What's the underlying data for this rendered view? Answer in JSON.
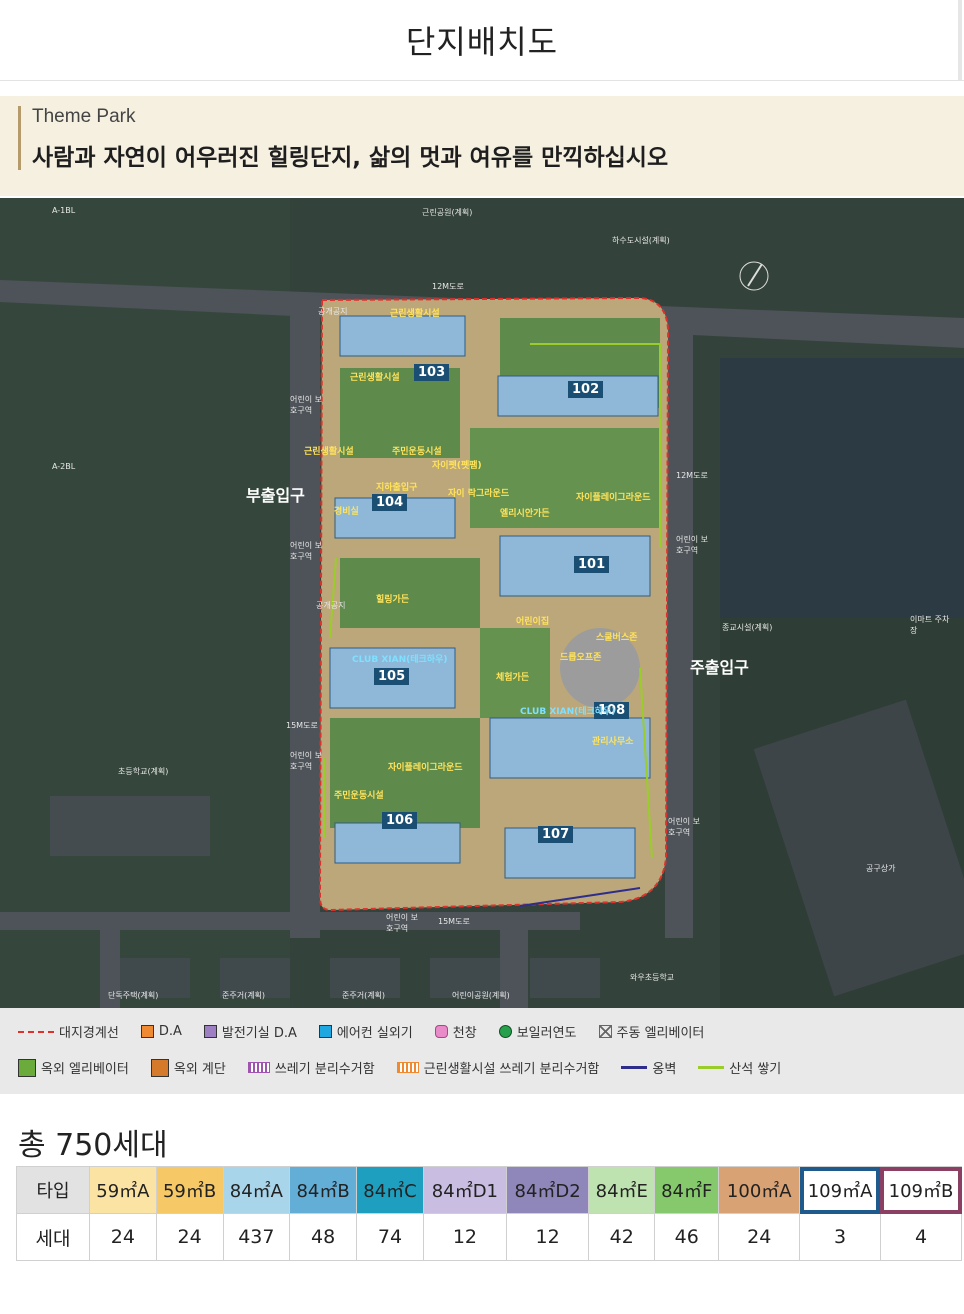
{
  "header": {
    "title": "단지배치도"
  },
  "banner": {
    "subtitle": "Theme Park",
    "tagline": "사람과 자연이 어우러진 힐링단지, 삶의 멋과 여유를 만끽하십시오"
  },
  "map": {
    "labels": {
      "a1": "A-1BL",
      "a2": "A-2BL",
      "park_top": "근린공원(계획)",
      "sewage": "하수도시설(계획)",
      "road12_top": "12M도로",
      "road12_right": "12M도로",
      "road15_left": "15M도로",
      "road15_bottom": "15M도로",
      "religion": "종교시설(계획)",
      "emart": "이마트 주차장",
      "school_elem": "초등학교(계획)",
      "public_store": "공구상가",
      "house": "단독주택(계획)",
      "semi1": "준주거(계획)",
      "semi2": "준주거(계획)",
      "kids_park": "어린이공원(계획)",
      "wau_school": "와우초등학교",
      "kids_zone1": "어린이 보호구역",
      "kids_zone2": "어린이 보호구역",
      "kids_zone3": "어린이 보호구역",
      "kids_zone4": "어린이 보호구역",
      "kids_zone5": "어린이 보호구역",
      "kids_zone6": "어린이 보호구역",
      "public_space1": "공개공지",
      "public_space2": "공개공지"
    },
    "entries": {
      "side": "부출입구",
      "main": "주출입구"
    },
    "buildings": [
      "101",
      "102",
      "103",
      "104",
      "105",
      "106",
      "107",
      "108"
    ],
    "facilities": {
      "f1": "근린생활시설",
      "f2": "근린생활시설",
      "f3": "근린생활시설",
      "f4": "주민운동시설",
      "f5": "자이펫(펫팸)",
      "f6": "경비실",
      "f7": "지하출입구",
      "f8": "자이 락그라운드",
      "f9": "엘리시안가든",
      "f10": "자이플레이그라운드",
      "f11": "힐링가든",
      "f12": "어린이집",
      "f13": "스쿨버스존",
      "f14": "드롭오프존",
      "f15": "체험가든",
      "f16": "자이플레이그라운드",
      "f17": "주민운동시설",
      "clubxian": "CLUB XIAN(테크하우)",
      "clubxian2": "CLUB XIAN(테크하우)",
      "f18": "관리사무소"
    }
  },
  "legend": {
    "row1": [
      {
        "label": "대지경계선",
        "kind": "dash",
        "color": "#e0302c"
      },
      {
        "label": "D.A",
        "kind": "box",
        "color": "#f08a32"
      },
      {
        "label": "발전기실 D.A",
        "kind": "box",
        "color": "#9f7fc3"
      },
      {
        "label": "에어컨 실외기",
        "kind": "box",
        "color": "#1ea7e0"
      },
      {
        "label": "천창",
        "kind": "hex",
        "color": "#e98bc8"
      },
      {
        "label": "보일러연도",
        "kind": "circle",
        "color": "#27a04c"
      },
      {
        "label": "주동 엘리베이터",
        "kind": "xbox",
        "color": "#666666"
      }
    ],
    "row2": [
      {
        "label": "옥외 엘리베이터",
        "kind": "elev",
        "color": "#6aab3c"
      },
      {
        "label": "옥외 계단",
        "kind": "stair",
        "color": "#d47a2a"
      },
      {
        "label": "쓰레기 분리수거함",
        "kind": "stripe",
        "color": "#9f55b0"
      },
      {
        "label": "근린생활시설 쓰레기 분리수거함",
        "kind": "stripe",
        "color": "#f08a32"
      },
      {
        "label": "옹벽",
        "kind": "line",
        "color": "#2e2d8c"
      },
      {
        "label": "산석 쌓기",
        "kind": "line",
        "color": "#9acd2a"
      }
    ]
  },
  "units": {
    "total": "총 750세대",
    "row_type": "타입",
    "row_count": "세대",
    "types": [
      {
        "label": "59㎡A",
        "count": "24",
        "color": "#fbe3a3"
      },
      {
        "label": "59㎡B",
        "count": "24",
        "color": "#f6c866"
      },
      {
        "label": "84㎡A",
        "count": "437",
        "color": "#a8d5ea"
      },
      {
        "label": "84㎡B",
        "count": "48",
        "color": "#63aed6"
      },
      {
        "label": "84㎡C",
        "count": "74",
        "color": "#1e9fc0"
      },
      {
        "label": "84㎡D1",
        "count": "12",
        "color": "#c9bde2"
      },
      {
        "label": "84㎡D2",
        "count": "12",
        "color": "#8f86b9"
      },
      {
        "label": "84㎡E",
        "count": "42",
        "color": "#bfe3b0"
      },
      {
        "label": "84㎡F",
        "count": "46",
        "color": "#86c96c"
      },
      {
        "label": "100㎡A",
        "count": "24",
        "color": "#d9a274"
      },
      {
        "label": "109㎡A",
        "count": "3",
        "color": "#ffffff"
      },
      {
        "label": "109㎡B",
        "count": "4",
        "color": "#ffffff"
      }
    ]
  }
}
